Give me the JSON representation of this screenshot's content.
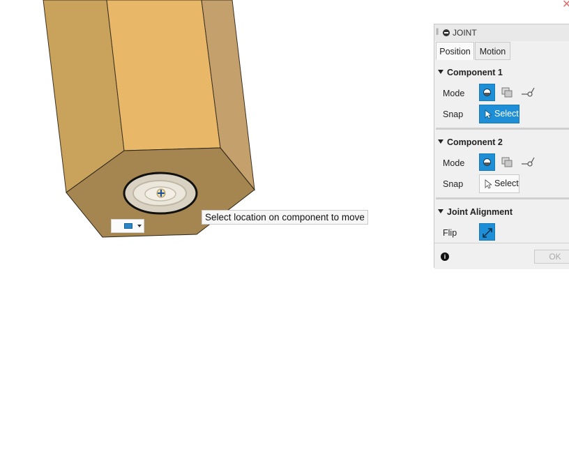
{
  "viewport": {
    "tooltip": "Select location on component to move",
    "close_glyph": "✕",
    "model_colors": {
      "face_top": "#e8b868",
      "face_left": "#c9a25c",
      "face_right": "#c4a06c",
      "face_bottom": "#a58550",
      "outline": "#333333"
    }
  },
  "panel": {
    "title": "JOINT",
    "tabs": [
      {
        "label": "Position",
        "active": true
      },
      {
        "label": "Motion",
        "active": false
      }
    ],
    "component1": {
      "heading": "Component 1",
      "mode_label": "Mode",
      "snap_label": "Snap",
      "select_label": "Select",
      "select_active": true
    },
    "component2": {
      "heading": "Component 2",
      "mode_label": "Mode",
      "snap_label": "Snap",
      "select_label": "Select",
      "select_active": false
    },
    "alignment": {
      "heading": "Joint Alignment",
      "flip_label": "Flip"
    },
    "footer": {
      "info_glyph": "i",
      "ok_label": "OK"
    },
    "accent_color": "#1e8fd6"
  }
}
